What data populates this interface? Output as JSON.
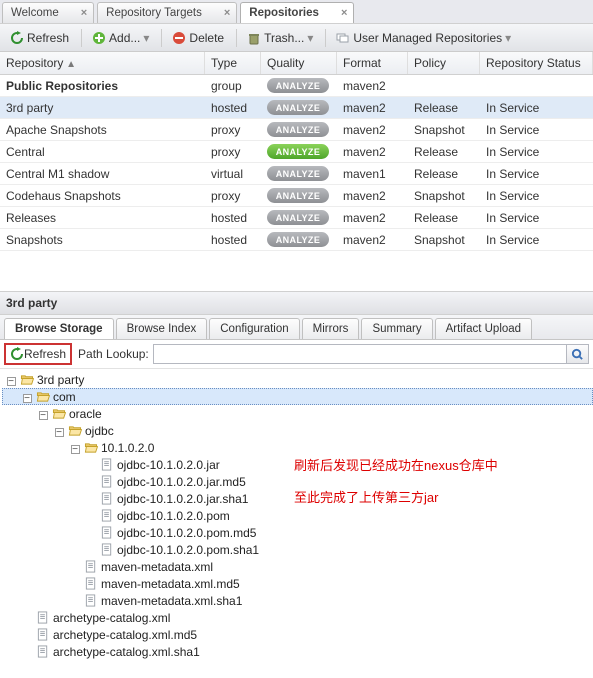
{
  "top_tabs": [
    {
      "label": "Welcome",
      "active": false
    },
    {
      "label": "Repository Targets",
      "active": false
    },
    {
      "label": "Repositories",
      "active": true
    }
  ],
  "toolbar": {
    "refresh": "Refresh",
    "add": "Add...",
    "delete": "Delete",
    "trash": "Trash...",
    "user_managed": "User Managed Repositories"
  },
  "grid": {
    "columns": [
      "Repository",
      "Type",
      "Quality",
      "Format",
      "Policy",
      "Repository Status"
    ],
    "rows": [
      {
        "repo": "Public Repositories",
        "type": "group",
        "quality": "ANALYZE",
        "quality_green": false,
        "format": "maven2",
        "policy": "",
        "status": "",
        "bold": true,
        "selected": false
      },
      {
        "repo": "3rd party",
        "type": "hosted",
        "quality": "ANALYZE",
        "quality_green": false,
        "format": "maven2",
        "policy": "Release",
        "status": "In Service",
        "bold": false,
        "selected": true
      },
      {
        "repo": "Apache Snapshots",
        "type": "proxy",
        "quality": "ANALYZE",
        "quality_green": false,
        "format": "maven2",
        "policy": "Snapshot",
        "status": "In Service",
        "bold": false,
        "selected": false
      },
      {
        "repo": "Central",
        "type": "proxy",
        "quality": "ANALYZE",
        "quality_green": true,
        "format": "maven2",
        "policy": "Release",
        "status": "In Service",
        "bold": false,
        "selected": false
      },
      {
        "repo": "Central M1 shadow",
        "type": "virtual",
        "quality": "ANALYZE",
        "quality_green": false,
        "format": "maven1",
        "policy": "Release",
        "status": "In Service",
        "bold": false,
        "selected": false
      },
      {
        "repo": "Codehaus Snapshots",
        "type": "proxy",
        "quality": "ANALYZE",
        "quality_green": false,
        "format": "maven2",
        "policy": "Snapshot",
        "status": "In Service",
        "bold": false,
        "selected": false
      },
      {
        "repo": "Releases",
        "type": "hosted",
        "quality": "ANALYZE",
        "quality_green": false,
        "format": "maven2",
        "policy": "Release",
        "status": "In Service",
        "bold": false,
        "selected": false
      },
      {
        "repo": "Snapshots",
        "type": "hosted",
        "quality": "ANALYZE",
        "quality_green": false,
        "format": "maven2",
        "policy": "Snapshot",
        "status": "In Service",
        "bold": false,
        "selected": false
      }
    ]
  },
  "lower_panel": {
    "title": "3rd party",
    "tabs": [
      "Browse Storage",
      "Browse Index",
      "Configuration",
      "Mirrors",
      "Summary",
      "Artifact Upload"
    ],
    "active_tab": 0,
    "refresh": "Refresh",
    "lookup_label": "Path Lookup:",
    "lookup_value": ""
  },
  "tree": [
    {
      "depth": 0,
      "expand": "-",
      "icon": "folder-open",
      "label": "3rd party",
      "sel": false
    },
    {
      "depth": 1,
      "expand": "-",
      "icon": "folder-open",
      "label": "com",
      "sel": true
    },
    {
      "depth": 2,
      "expand": "-",
      "icon": "folder-open",
      "label": "oracle",
      "sel": false
    },
    {
      "depth": 3,
      "expand": "-",
      "icon": "folder-open",
      "label": "ojdbc",
      "sel": false
    },
    {
      "depth": 4,
      "expand": "-",
      "icon": "folder-open",
      "label": "10.1.0.2.0",
      "sel": false
    },
    {
      "depth": 5,
      "expand": "",
      "icon": "file",
      "label": "ojdbc-10.1.0.2.0.jar",
      "sel": false
    },
    {
      "depth": 5,
      "expand": "",
      "icon": "file",
      "label": "ojdbc-10.1.0.2.0.jar.md5",
      "sel": false
    },
    {
      "depth": 5,
      "expand": "",
      "icon": "file",
      "label": "ojdbc-10.1.0.2.0.jar.sha1",
      "sel": false
    },
    {
      "depth": 5,
      "expand": "",
      "icon": "file",
      "label": "ojdbc-10.1.0.2.0.pom",
      "sel": false
    },
    {
      "depth": 5,
      "expand": "",
      "icon": "file",
      "label": "ojdbc-10.1.0.2.0.pom.md5",
      "sel": false
    },
    {
      "depth": 5,
      "expand": "",
      "icon": "file",
      "label": "ojdbc-10.1.0.2.0.pom.sha1",
      "sel": false
    },
    {
      "depth": 4,
      "expand": "",
      "icon": "file",
      "label": "maven-metadata.xml",
      "sel": false
    },
    {
      "depth": 4,
      "expand": "",
      "icon": "file",
      "label": "maven-metadata.xml.md5",
      "sel": false
    },
    {
      "depth": 4,
      "expand": "",
      "icon": "file",
      "label": "maven-metadata.xml.sha1",
      "sel": false
    },
    {
      "depth": 1,
      "expand": "",
      "icon": "file",
      "label": "archetype-catalog.xml",
      "sel": false
    },
    {
      "depth": 1,
      "expand": "",
      "icon": "file",
      "label": "archetype-catalog.xml.md5",
      "sel": false
    },
    {
      "depth": 1,
      "expand": "",
      "icon": "file",
      "label": "archetype-catalog.xml.sha1",
      "sel": false
    }
  ],
  "annotations": {
    "line1": "刷新后发现已经成功在nexus仓库中",
    "line2": "至此完成了上传第三方jar"
  }
}
